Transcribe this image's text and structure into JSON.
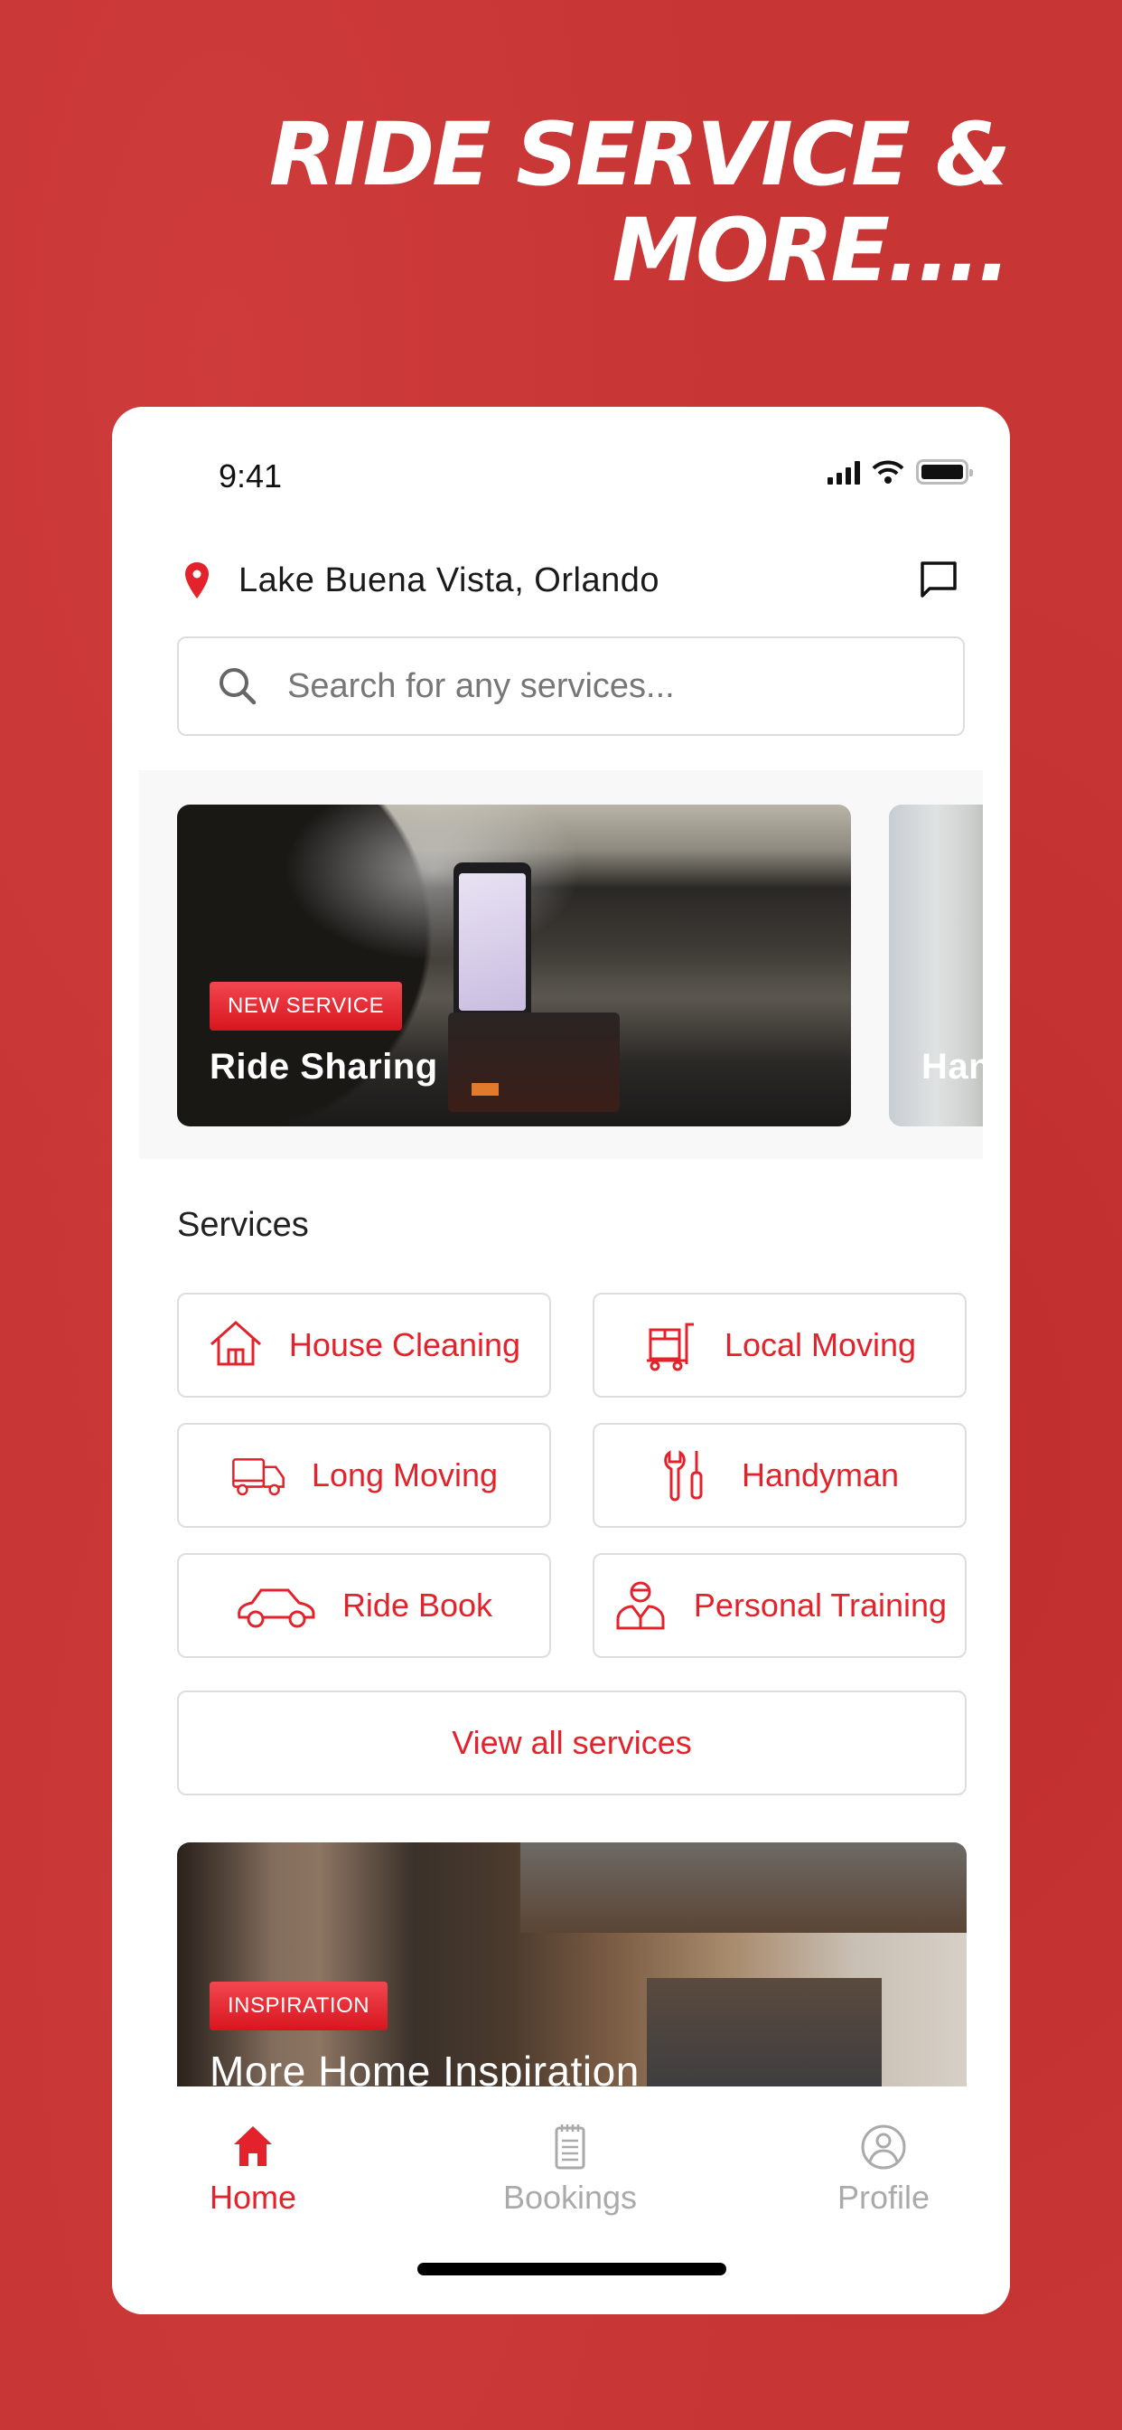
{
  "headline": {
    "line1": "RIDE SERVICE &",
    "line2": "MORE...."
  },
  "colors": {
    "accent": "#e3222b",
    "background": "#c73535",
    "inactive": "#aaaaaa"
  },
  "status_bar": {
    "time": "9:41",
    "icons": [
      "signal-icon",
      "wifi-icon",
      "battery-icon"
    ]
  },
  "header": {
    "location": "Lake Buena Vista, Orlando",
    "location_icon": "map-pin-icon",
    "chat_icon": "chat-icon"
  },
  "search": {
    "placeholder": "Search for any services...",
    "value": "",
    "icon": "search-icon"
  },
  "carousel": {
    "cards": [
      {
        "badge": "NEW SERVICE",
        "title": "Ride Sharing"
      },
      {
        "badge": "",
        "title": "Handyman"
      }
    ]
  },
  "services": {
    "title": "Services",
    "items": [
      {
        "label": "House Cleaning",
        "icon": "house-icon"
      },
      {
        "label": "Local Moving",
        "icon": "hand-truck-icon"
      },
      {
        "label": "Long Moving",
        "icon": "truck-icon"
      },
      {
        "label": "Handyman",
        "icon": "tools-icon"
      },
      {
        "label": "Ride Book",
        "icon": "car-icon"
      },
      {
        "label": "Personal Training",
        "icon": "trainer-icon"
      }
    ],
    "view_all": "View all services"
  },
  "inspiration": {
    "badge": "INSPIRATION",
    "title": "More Home Inspiration"
  },
  "tab_bar": {
    "tabs": [
      {
        "label": "Home",
        "icon": "home-icon",
        "active": true
      },
      {
        "label": "Bookings",
        "icon": "notepad-icon",
        "active": false
      },
      {
        "label": "Profile",
        "icon": "profile-icon",
        "active": false
      }
    ]
  }
}
